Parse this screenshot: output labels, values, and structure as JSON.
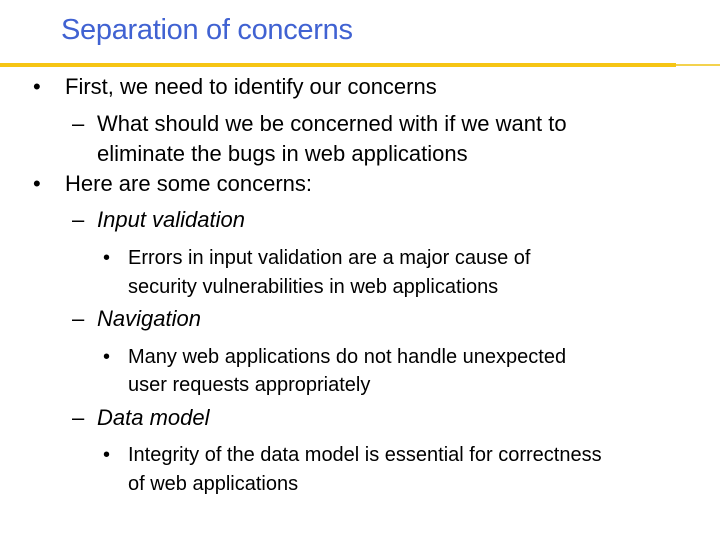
{
  "slide": {
    "title": "Separation of concerns",
    "accent_colors": {
      "title": "#4062d2",
      "rule": "#f6c514"
    },
    "markers": {
      "bullet": "•",
      "dash": "–"
    },
    "items": [
      {
        "level": 1,
        "lines": [
          "First, we need to identify our concerns"
        ]
      },
      {
        "level": 2,
        "lines": [
          "What should we be concerned with if we want to",
          "eliminate the bugs in web applications"
        ]
      },
      {
        "level": 1,
        "lines": [
          "Here are some concerns:"
        ]
      },
      {
        "level": 2,
        "italic": true,
        "lines": [
          "Input validation"
        ]
      },
      {
        "level": 3,
        "lines": [
          "Errors in input validation are a major cause of",
          "security vulnerabilities in web applications"
        ]
      },
      {
        "level": 2,
        "italic": true,
        "lines": [
          "Navigation"
        ]
      },
      {
        "level": 3,
        "lines": [
          "Many web applications do not handle unexpected",
          "user requests appropriately"
        ]
      },
      {
        "level": 2,
        "italic": true,
        "lines": [
          "Data model"
        ]
      },
      {
        "level": 3,
        "lines": [
          "Integrity of the data model is essential for correctness",
          "of web applications"
        ]
      }
    ]
  }
}
